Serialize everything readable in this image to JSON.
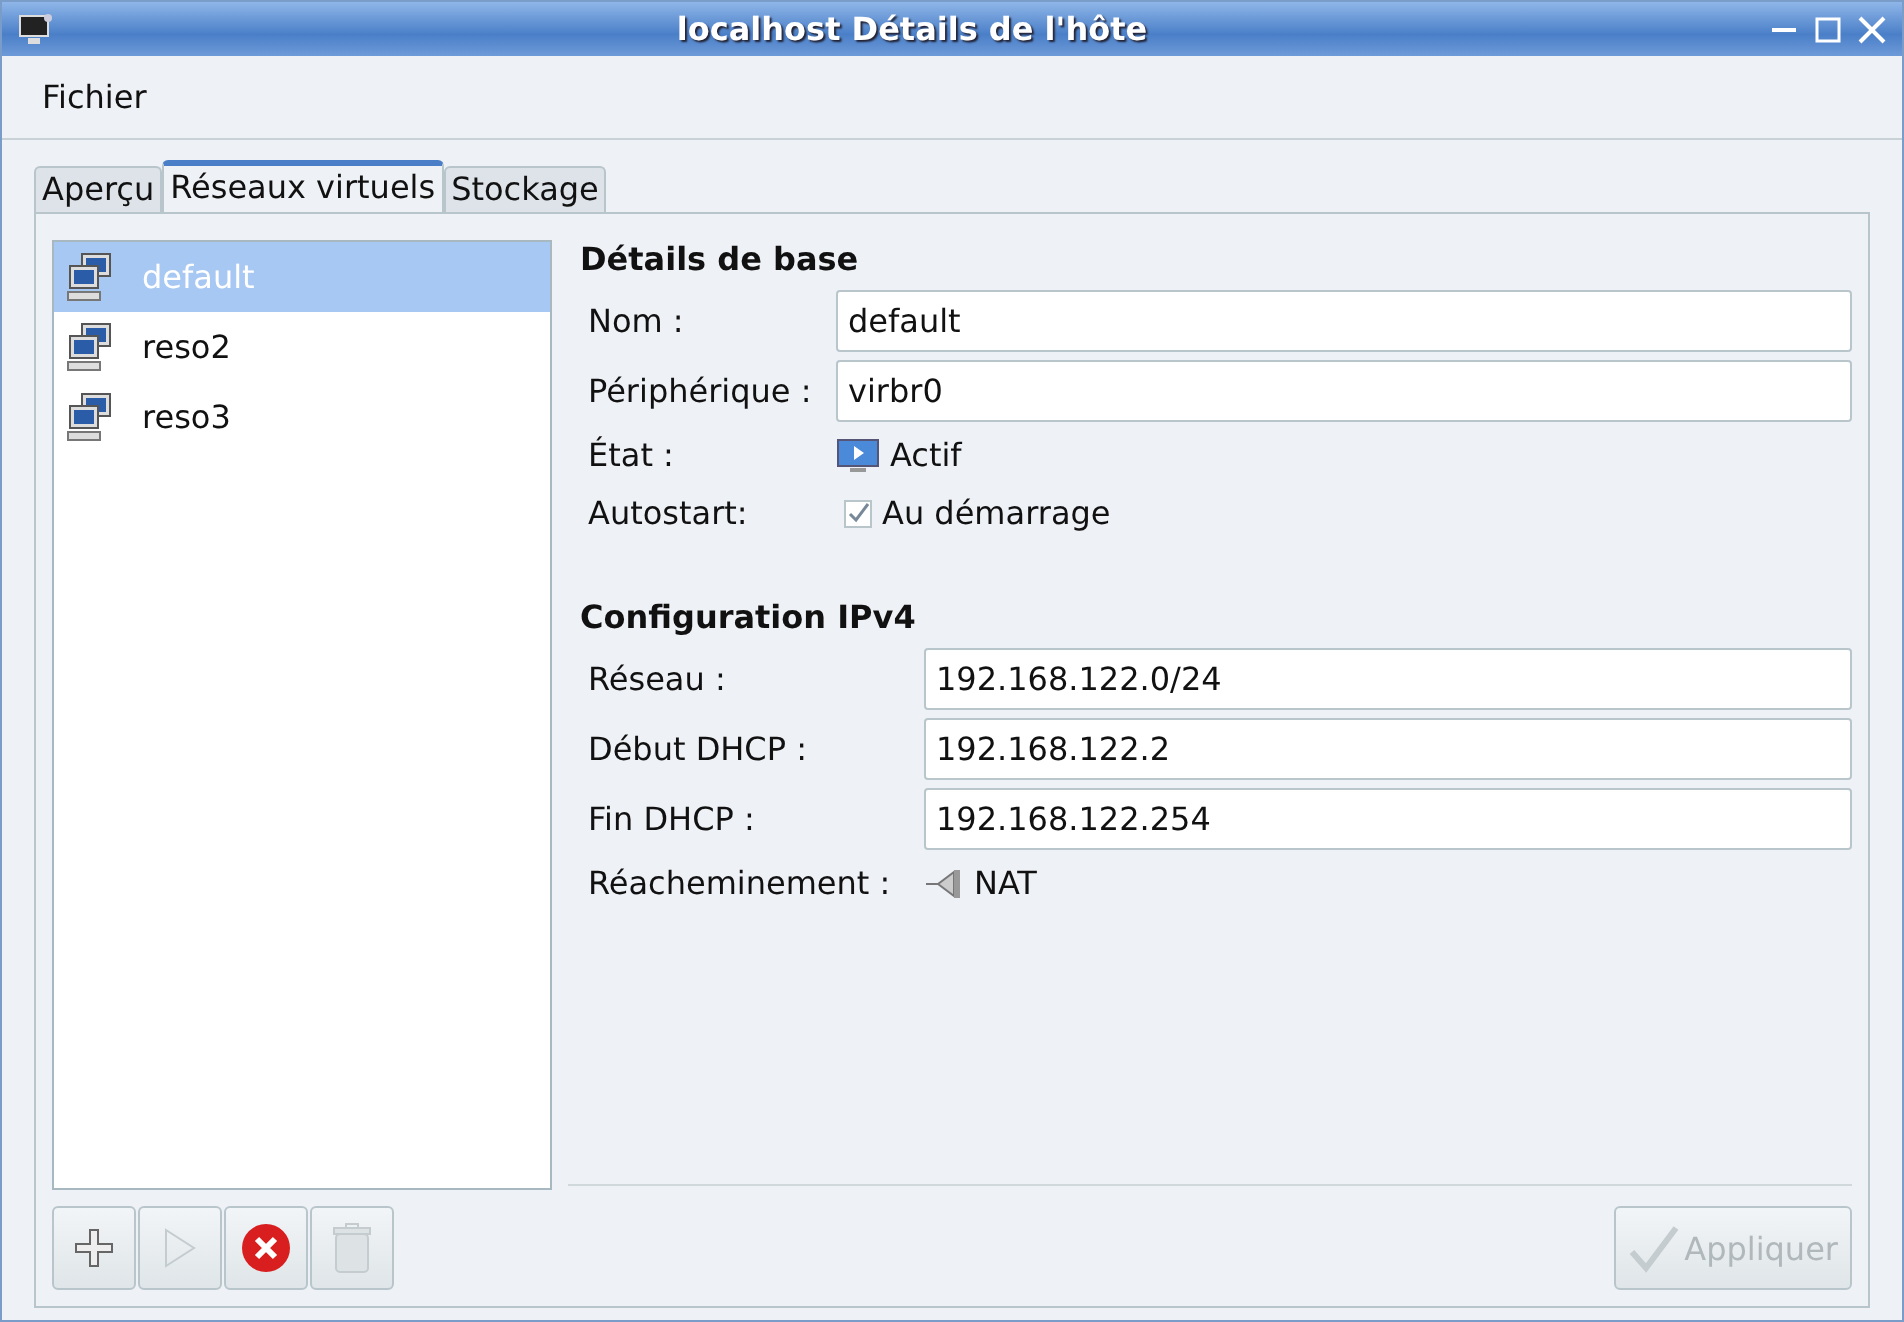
{
  "window": {
    "title": "localhost Détails de l'hôte"
  },
  "menu": [
    "Fichier"
  ],
  "tabs": [
    {
      "label": "Aperçu",
      "selected": false
    },
    {
      "label": "Réseaux virtuels",
      "selected": true
    },
    {
      "label": "Stockage",
      "selected": false
    }
  ],
  "networks": [
    {
      "name": "default",
      "selected": true
    },
    {
      "name": "reso2",
      "selected": false
    },
    {
      "name": "reso3",
      "selected": false
    }
  ],
  "list_buttons": [
    {
      "kind": "add",
      "disabled": false
    },
    {
      "kind": "start",
      "disabled": true
    },
    {
      "kind": "stop",
      "disabled": false
    },
    {
      "kind": "delete",
      "disabled": true
    }
  ],
  "basic": {
    "heading": "Détails de base",
    "fields": [
      {
        "kind": "entry",
        "label": "Nom :",
        "value": "default"
      },
      {
        "kind": "entry",
        "label": "Périphérique :",
        "value": "virbr0"
      },
      {
        "kind": "state",
        "label": "État :",
        "value": "Actif"
      },
      {
        "kind": "check",
        "label": "Autostart:",
        "value": "Au démarrage",
        "checked": true
      }
    ]
  },
  "ipv4": {
    "heading": "Configuration IPv4",
    "fields": [
      {
        "kind": "entry",
        "label": "Réseau :",
        "value": "192.168.122.0/24"
      },
      {
        "kind": "entry",
        "label": "Début DHCP :",
        "value": "192.168.122.2"
      },
      {
        "kind": "entry",
        "label": "Fin DHCP :",
        "value": "192.168.122.254"
      },
      {
        "kind": "forward",
        "label": "Réacheminement :",
        "value": "NAT"
      }
    ]
  },
  "apply_button": {
    "label": "Appliquer",
    "disabled": true
  }
}
